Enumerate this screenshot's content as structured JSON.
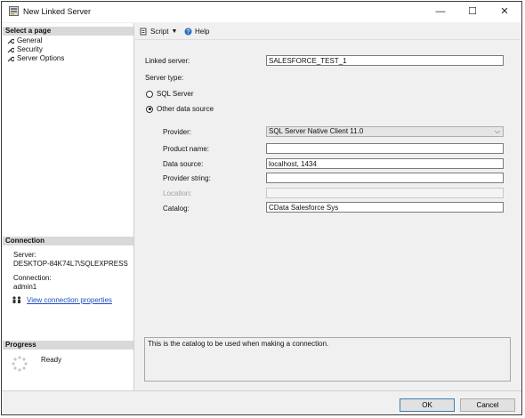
{
  "window": {
    "title": "New Linked Server",
    "min": "—",
    "max": "☐",
    "close": "✕"
  },
  "sidebar": {
    "select_page_header": "Select a page",
    "pages": [
      {
        "label": "General"
      },
      {
        "label": "Security"
      },
      {
        "label": "Server Options"
      }
    ],
    "connection_header": "Connection",
    "server_label": "Server:",
    "server_value": "DESKTOP-84K74L7\\SQLEXPRESS",
    "connection_label": "Connection:",
    "connection_value": "admin1",
    "view_connection_link": "View connection properties",
    "progress_header": "Progress",
    "progress_status": "Ready"
  },
  "toolbar": {
    "script_label": "Script",
    "help_label": "Help"
  },
  "form": {
    "linked_server_label": "Linked server:",
    "linked_server_value": "SALESFORCE_TEST_1",
    "server_type_label": "Server type:",
    "radio_sql_server": "SQL Server",
    "radio_other": "Other data source",
    "selected_server_type": "Other data source",
    "provider_label": "Provider:",
    "provider_value": "SQL Server Native Client 11.0",
    "product_name_label": "Product name:",
    "product_name_value": "",
    "data_source_label": "Data source:",
    "data_source_value": "localhost, 1434",
    "provider_string_label": "Provider string:",
    "provider_string_value": "",
    "location_label": "Location:",
    "location_value": "",
    "catalog_label": "Catalog:",
    "catalog_value": "CData Salesforce Sys"
  },
  "description": "This is the catalog to be used when making a connection.",
  "buttons": {
    "ok": "OK",
    "cancel": "Cancel"
  }
}
